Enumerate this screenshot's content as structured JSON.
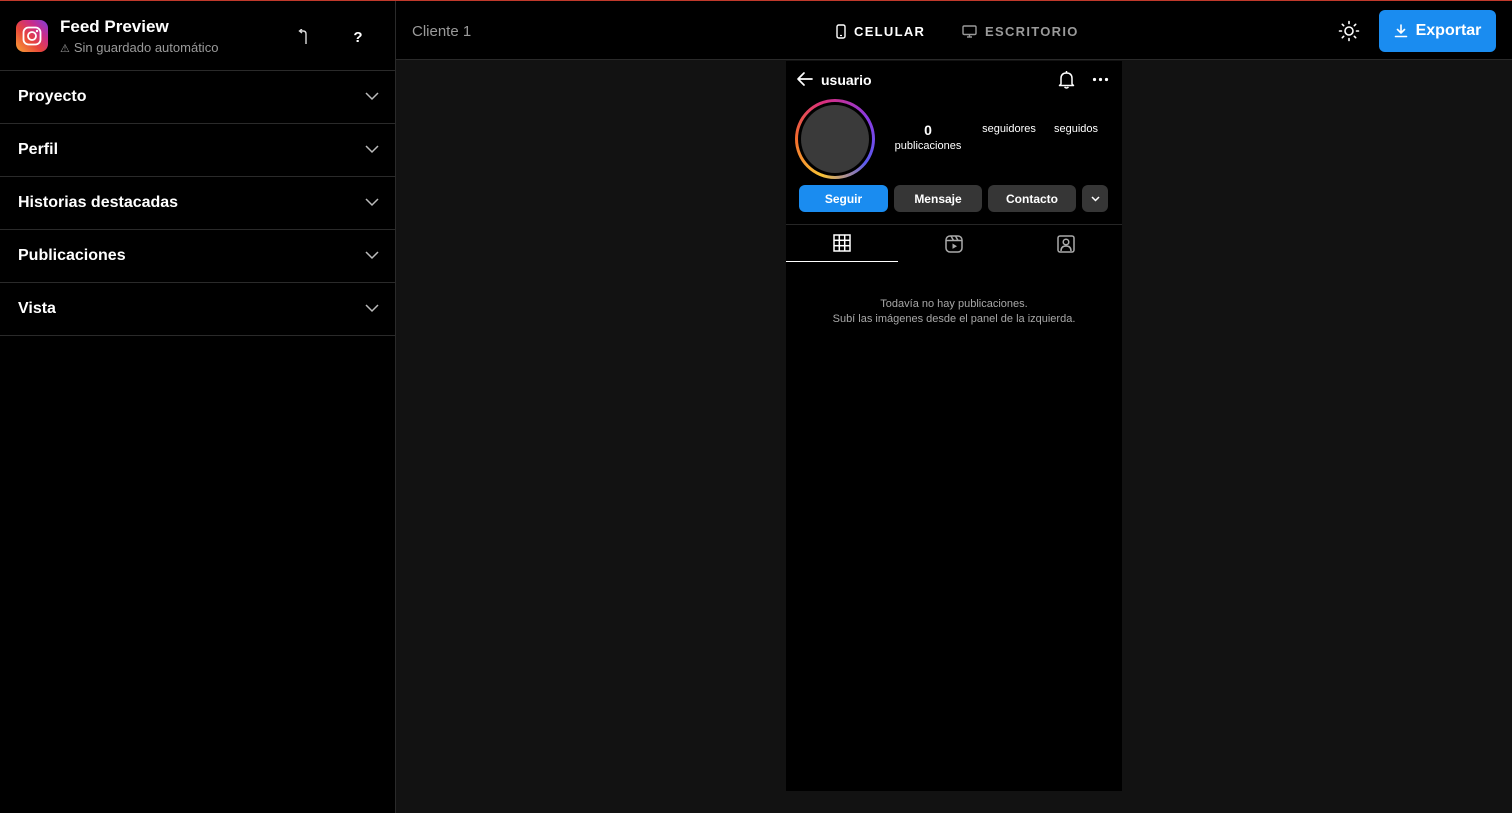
{
  "sidebar": {
    "app_title": "Feed Preview",
    "save_status": "Sin guardado automático",
    "help_label": "?",
    "sections": [
      {
        "label": "Proyecto"
      },
      {
        "label": "Perfil"
      },
      {
        "label": "Historias destacadas"
      },
      {
        "label": "Publicaciones"
      },
      {
        "label": "Vista"
      }
    ]
  },
  "topbar": {
    "client_name": "Cliente 1",
    "view_mobile": "CELULAR",
    "view_desktop": "ESCRITORIO",
    "export_label": "Exportar"
  },
  "profile": {
    "username": "usuario",
    "posts_count": "0",
    "posts_label": "publicaciones",
    "followers_label": "seguidores",
    "following_label": "seguidos",
    "follow_label": "Seguir",
    "message_label": "Mensaje",
    "contact_label": "Contacto",
    "empty_line1": "Todavía no hay publicaciones.",
    "empty_line2": "Subí las imágenes desde el panel de la izquierda."
  },
  "colors": {
    "accent": "#1a8cf0",
    "background": "#000000",
    "canvas": "#121212"
  }
}
